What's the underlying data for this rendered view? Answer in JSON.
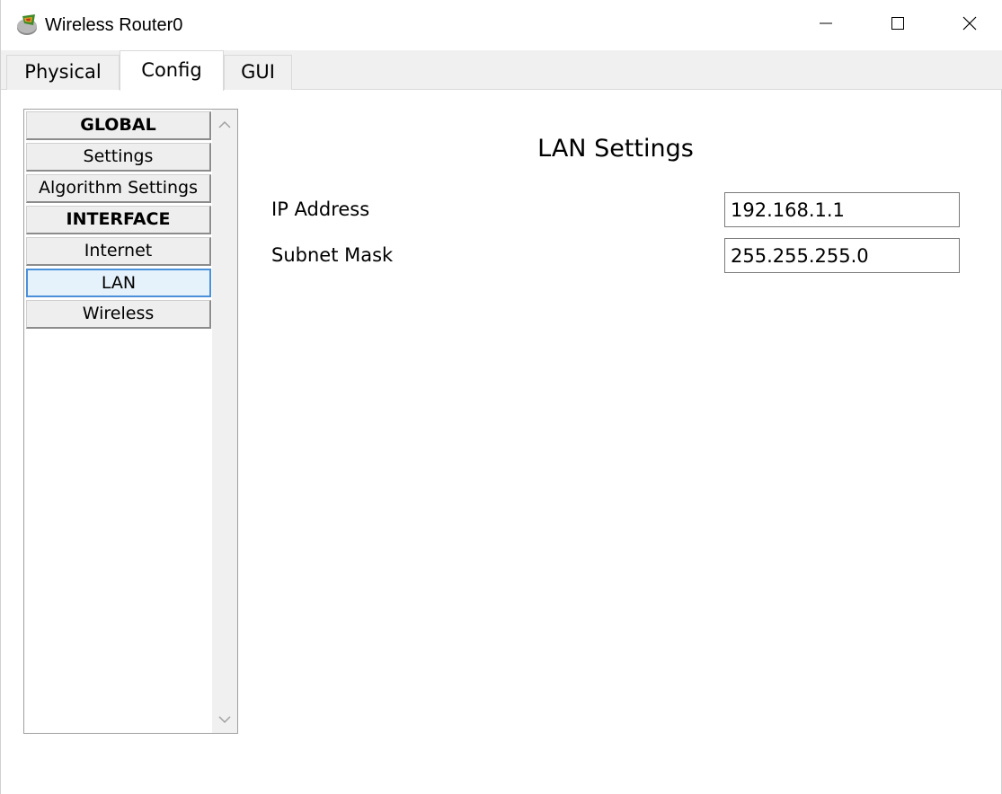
{
  "window": {
    "title": "Wireless Router0",
    "app_icon": "router-icon",
    "controls": {
      "minimize": "minimize-icon",
      "maximize": "maximize-icon",
      "close": "close-icon"
    }
  },
  "tabs": [
    {
      "label": "Physical",
      "active": false
    },
    {
      "label": "Config",
      "active": true
    },
    {
      "label": "GUI",
      "active": false
    }
  ],
  "sidebar": {
    "items": [
      {
        "label": "GLOBAL",
        "type": "header"
      },
      {
        "label": "Settings",
        "type": "item"
      },
      {
        "label": "Algorithm Settings",
        "type": "item"
      },
      {
        "label": "INTERFACE",
        "type": "header"
      },
      {
        "label": "Internet",
        "type": "item"
      },
      {
        "label": "LAN",
        "type": "item",
        "selected": true
      },
      {
        "label": "Wireless",
        "type": "item"
      }
    ],
    "scroll_up_icon": "chevron-up-icon",
    "scroll_down_icon": "chevron-down-icon"
  },
  "panel": {
    "title": "LAN Settings",
    "fields": [
      {
        "label": "IP Address",
        "value": "192.168.1.1"
      },
      {
        "label": "Subnet Mask",
        "value": "255.255.255.0"
      }
    ]
  }
}
